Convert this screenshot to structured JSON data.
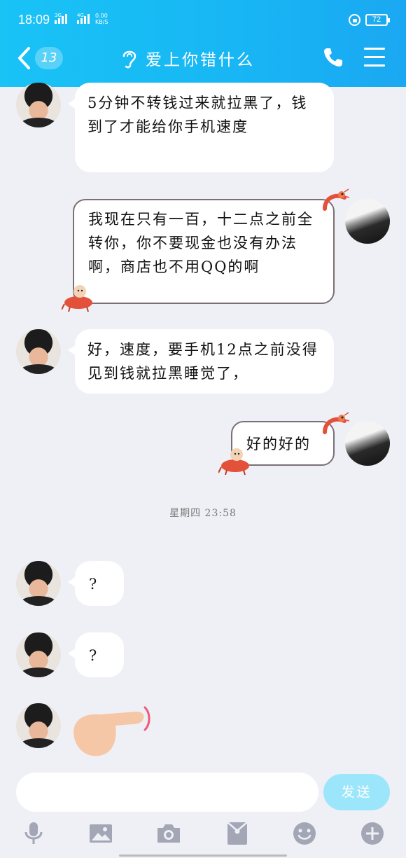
{
  "status_bar": {
    "time": "18:09",
    "signal1_label": "3G",
    "signal2_label": "4G",
    "net_speed_value": "0.00",
    "net_speed_unit": "KB/S",
    "battery": "72"
  },
  "header": {
    "back_badge": "13",
    "title": "爱上你错什么"
  },
  "messages": [
    {
      "side": "left",
      "text": "5分钟不转钱过来就拉黑了，钱到了才能给你手机速度"
    },
    {
      "side": "right",
      "text": "我现在只有一百，十二点之前全转你，你不要现金也没有办法啊，商店也不用QQ的啊"
    },
    {
      "side": "left",
      "text": "好，速度，要手机12点之前没得见到钱就拉黑睡觉了，"
    },
    {
      "side": "right",
      "text": "好的好的"
    },
    {
      "side": "left",
      "text": "?"
    },
    {
      "side": "left",
      "text": "?"
    }
  ],
  "timestamp": "星期四 23:58",
  "input": {
    "send_label": "发送"
  },
  "toolbar": {
    "icons": [
      "microphone-icon",
      "image-icon",
      "camera-icon",
      "red-envelope-icon",
      "emoji-icon",
      "plus-icon"
    ]
  },
  "colors": {
    "header": "#18b7f4",
    "send_button": "#9ce6fb",
    "background": "#eff0f6"
  }
}
